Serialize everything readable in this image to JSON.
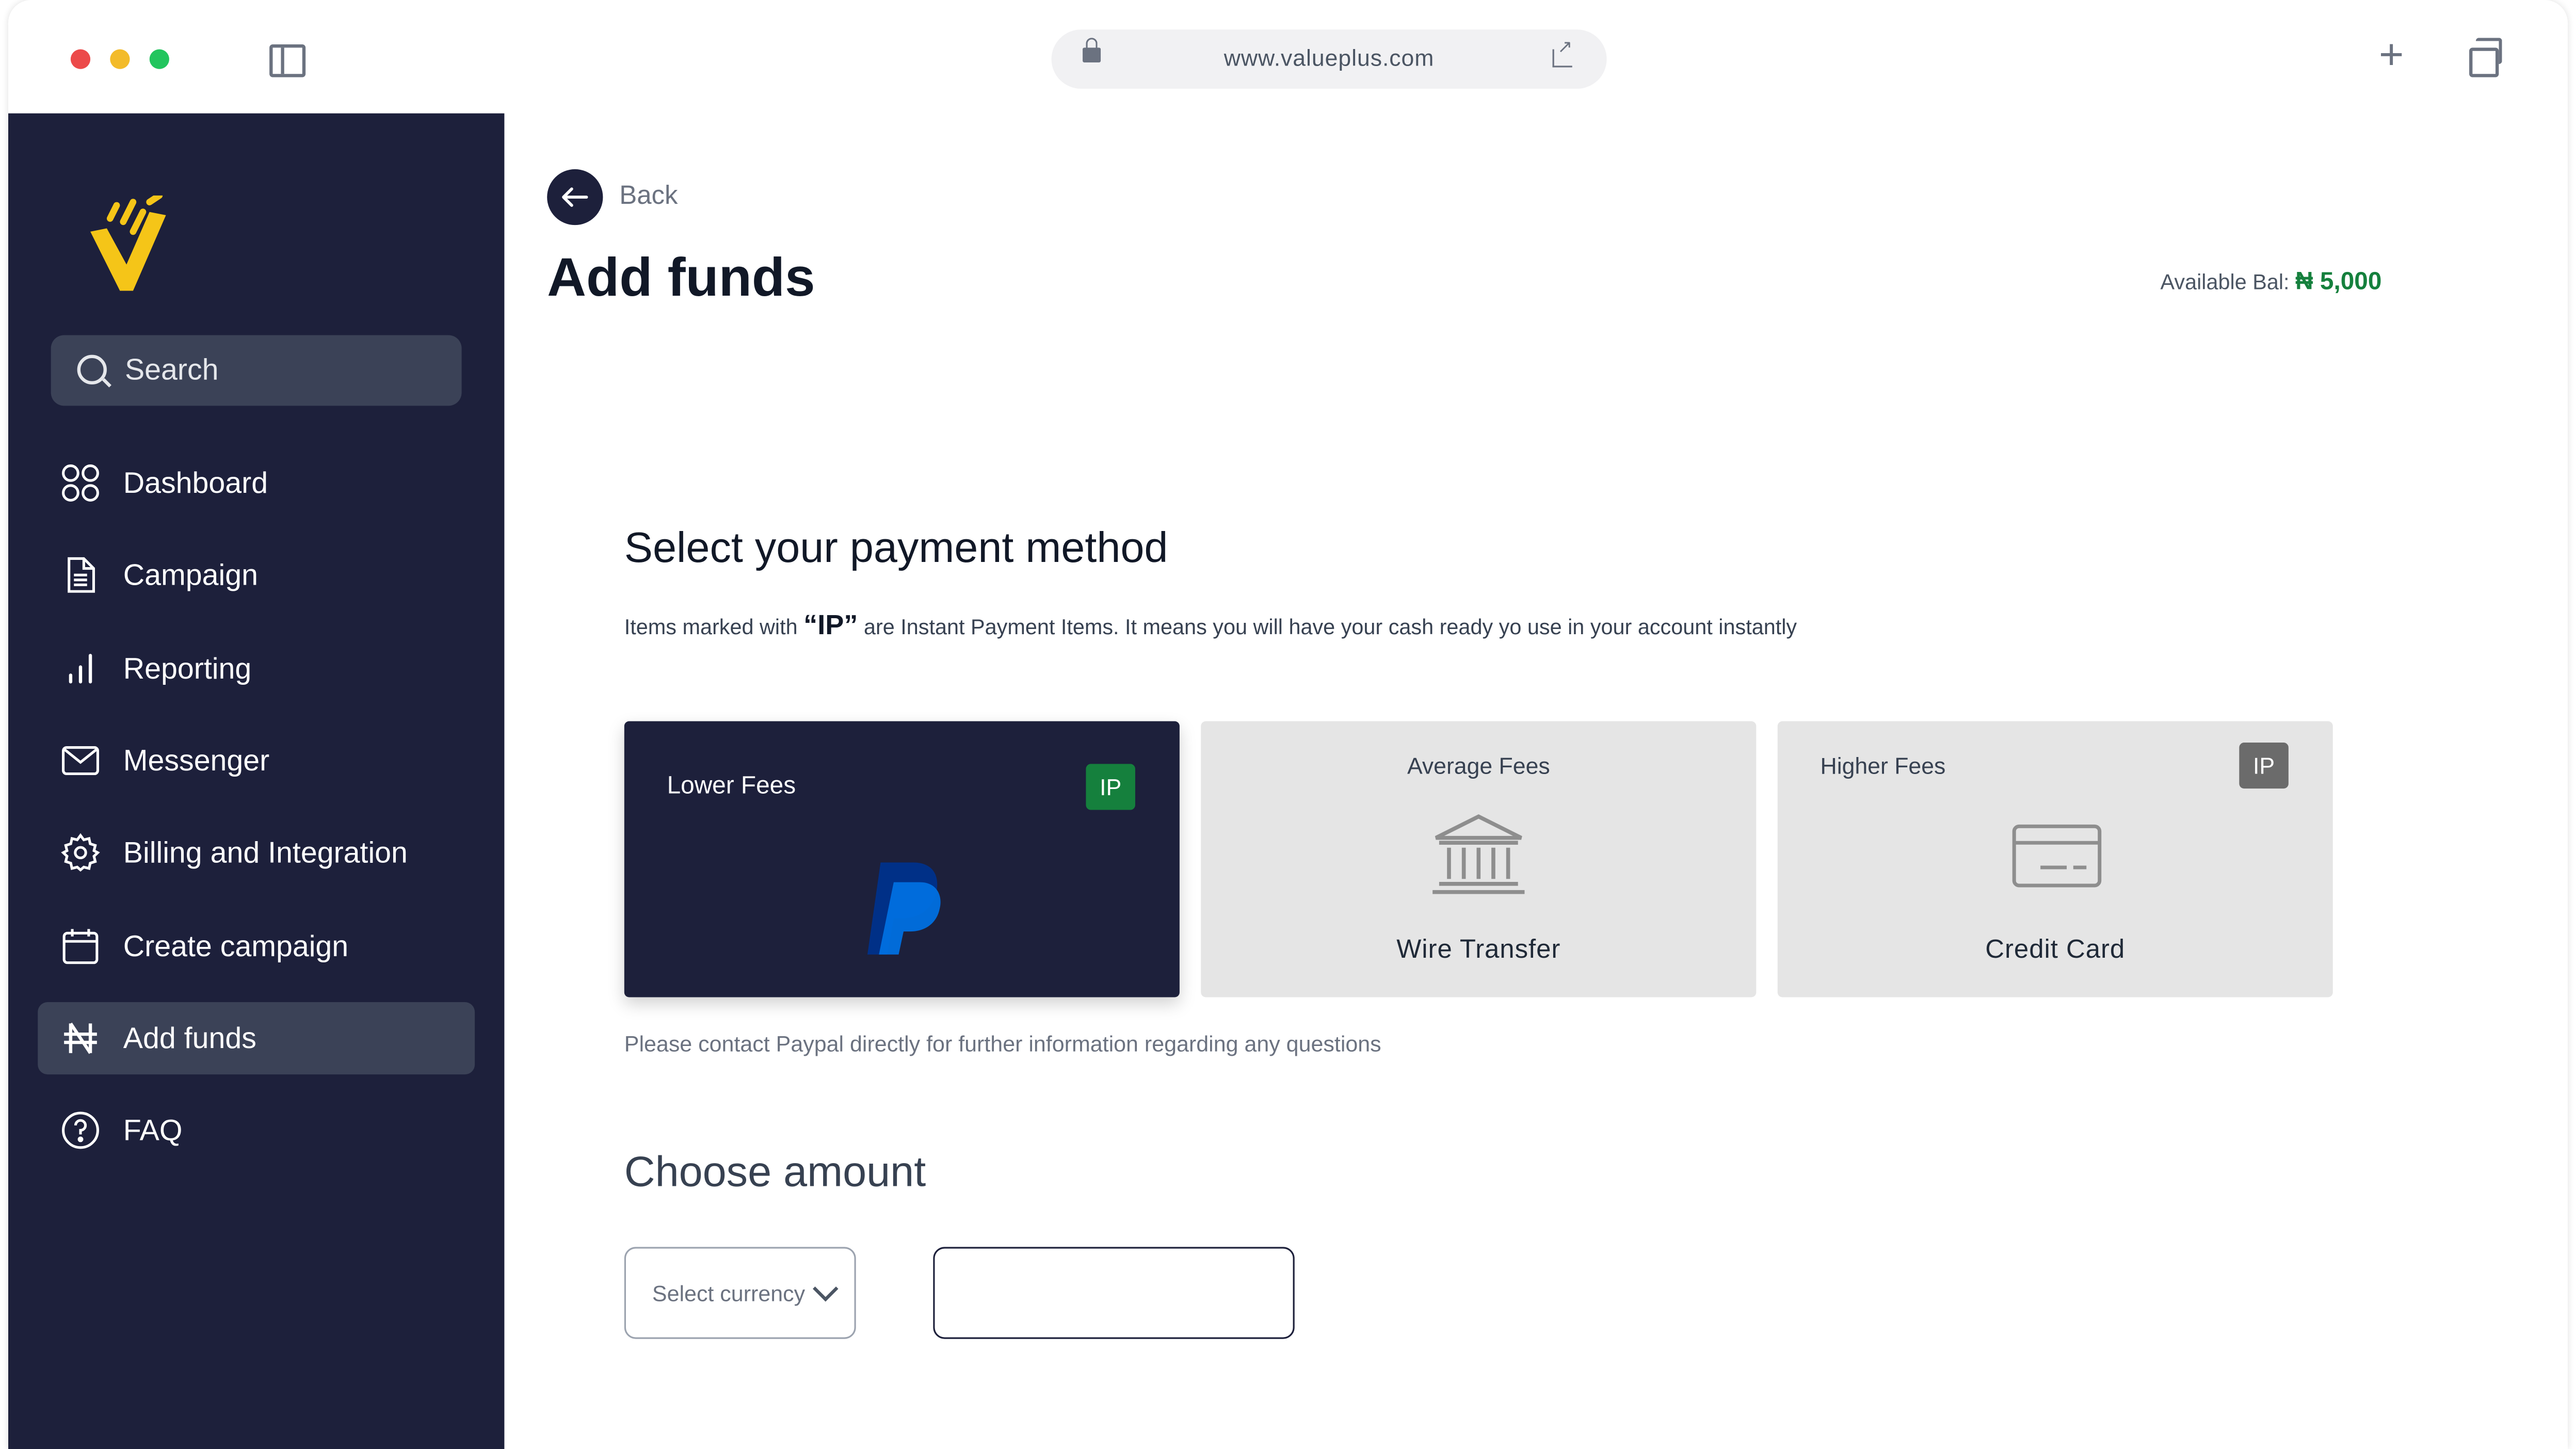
{
  "browser": {
    "url": "www.valueplus.com"
  },
  "sidebar": {
    "search_label": "Search",
    "items": [
      {
        "label": "Dashboard",
        "icon": "dashboard-grid-icon"
      },
      {
        "label": "Campaign",
        "icon": "document-icon"
      },
      {
        "label": "Reporting",
        "icon": "bar-chart-icon"
      },
      {
        "label": "Messenger",
        "icon": "mail-icon"
      },
      {
        "label": "Billing and Integration",
        "icon": "gear-icon"
      },
      {
        "label": "Create campaign",
        "icon": "calendar-icon"
      },
      {
        "label": "Add funds",
        "icon": "naira-icon",
        "active": true
      },
      {
        "label": "FAQ",
        "icon": "help-circle-icon"
      }
    ]
  },
  "header": {
    "back_label": "Back",
    "title": "Add funds",
    "balance_label": "Available Bal:",
    "balance_value": "₦ 5,000"
  },
  "payment": {
    "heading": "Select your payment method",
    "desc_prefix": "Items marked with",
    "desc_ip": "“IP”",
    "desc_suffix": "are Instant Payment Items. It means you will have your cash ready yo use in your account instantly",
    "methods": [
      {
        "fee": "Lower Fees",
        "name": "",
        "badge": "IP",
        "icon": "paypal-icon",
        "selected": true
      },
      {
        "fee": "Average Fees",
        "name": "Wire Transfer",
        "badge": "",
        "icon": "bank-icon",
        "selected": false
      },
      {
        "fee": "Higher Fees",
        "name": "Credit Card",
        "badge": "IP",
        "icon": "credit-card-icon",
        "selected": false
      }
    ],
    "note": "Please contact Paypal directly for further information regarding any questions"
  },
  "amount": {
    "heading": "Choose amount",
    "currency_placeholder": "Select currency",
    "amount_value": ""
  },
  "colors": {
    "sidebar_bg": "#1d203b",
    "active_item_bg": "#3b4257",
    "accent_green": "#15803d",
    "logo_yellow": "#f5c518",
    "paypal_dark": "#003087",
    "paypal_light": "#0070e0"
  }
}
